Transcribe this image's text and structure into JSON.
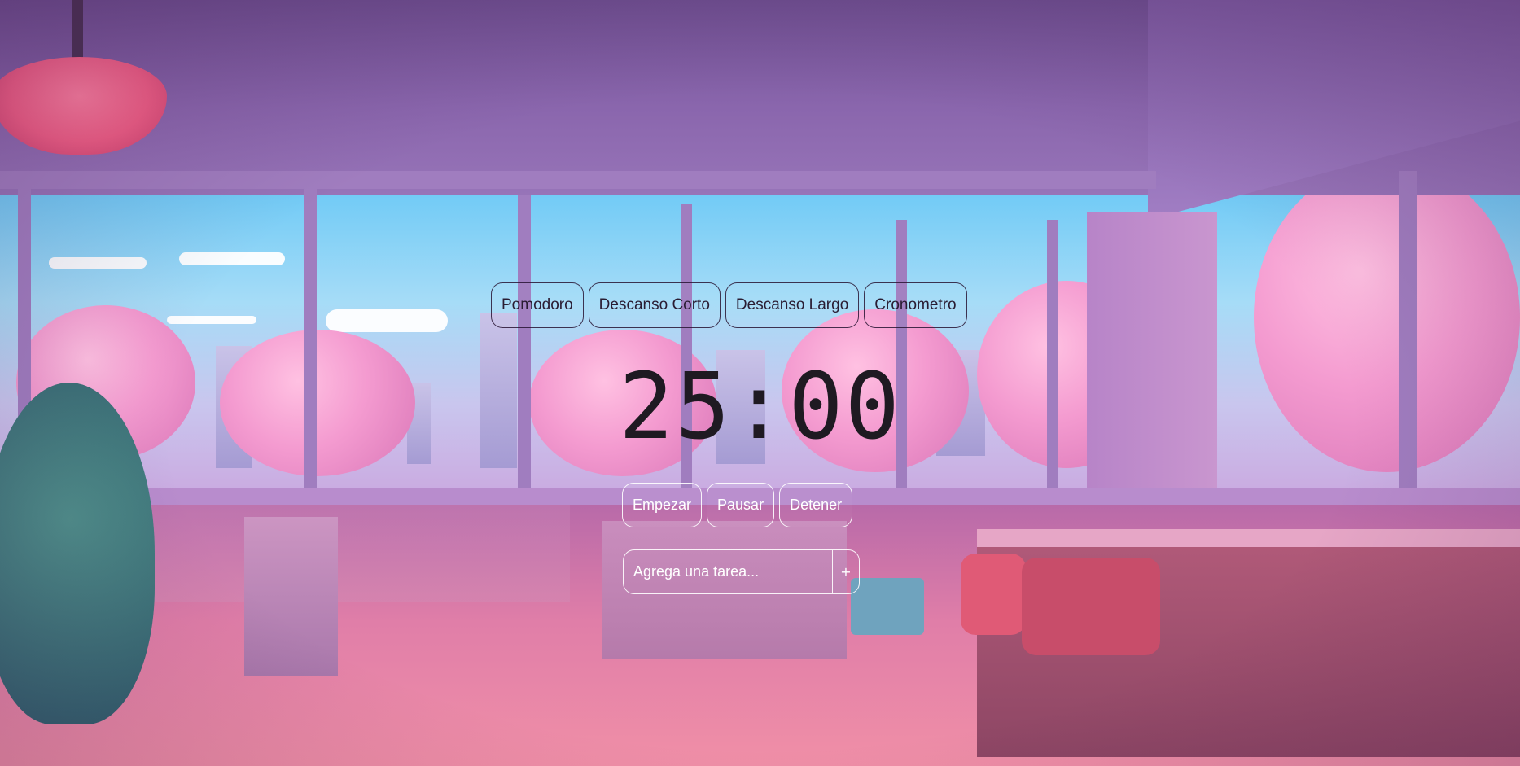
{
  "modes": [
    {
      "label": "Pomodoro"
    },
    {
      "label": "Descanso Corto"
    },
    {
      "label": "Descanso Largo"
    },
    {
      "label": "Cronometro"
    }
  ],
  "timer": {
    "display": "25:00"
  },
  "controls": {
    "start_label": "Empezar",
    "pause_label": "Pausar",
    "stop_label": "Detener"
  },
  "task": {
    "placeholder": "Agrega una tarea...",
    "add_label": "+"
  },
  "background": {
    "description_icon": "lofi-room-background"
  },
  "colors": {
    "text_dark": "#2a1d33",
    "border_light": "#ffffff"
  }
}
